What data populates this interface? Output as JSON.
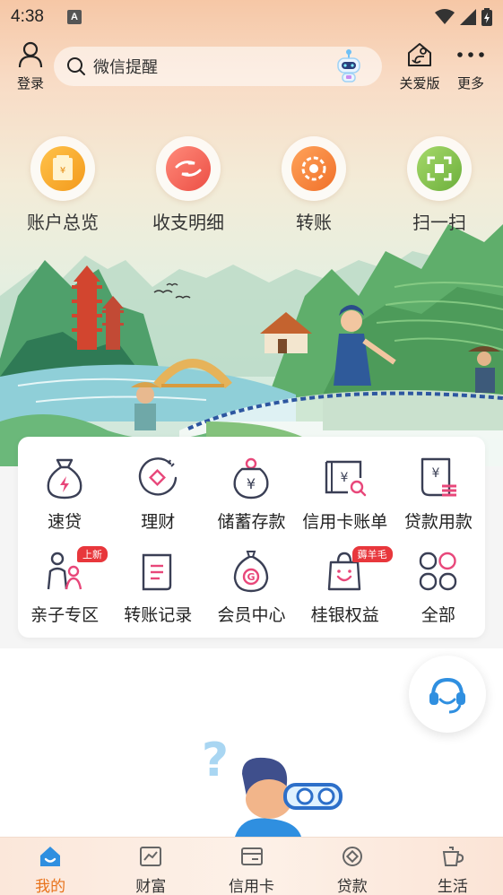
{
  "status_bar": {
    "time": "4:38",
    "notification_letter": "A"
  },
  "top_nav": {
    "login_label": "登录",
    "search_placeholder": "微信提醒",
    "care_label": "关爱版",
    "more_label": "更多"
  },
  "quick_actions": [
    {
      "label": "账户总览",
      "icon": "account-icon",
      "color": "#f5a623"
    },
    {
      "label": "收支明细",
      "icon": "income-expense-icon",
      "color": "#f06a5a"
    },
    {
      "label": "转账",
      "icon": "transfer-icon",
      "color": "#f58a3a"
    },
    {
      "label": "扫一扫",
      "icon": "scan-icon",
      "color": "#7fbf4d"
    }
  ],
  "services": [
    {
      "label": "速贷",
      "icon": "quick-loan-icon"
    },
    {
      "label": "理财",
      "icon": "wealth-icon"
    },
    {
      "label": "储蓄存款",
      "icon": "savings-icon"
    },
    {
      "label": "信用卡账单",
      "icon": "credit-bill-icon"
    },
    {
      "label": "贷款用款",
      "icon": "loan-use-icon"
    },
    {
      "label": "亲子专区",
      "icon": "family-icon",
      "badge": "上新"
    },
    {
      "label": "转账记录",
      "icon": "transfer-record-icon"
    },
    {
      "label": "会员中心",
      "icon": "member-icon"
    },
    {
      "label": "桂银权益",
      "icon": "benefits-icon",
      "badge": "薅羊毛"
    },
    {
      "label": "全部",
      "icon": "all-icon"
    }
  ],
  "tabs": [
    {
      "label": "我的",
      "icon": "home-icon",
      "active": true
    },
    {
      "label": "财富",
      "icon": "wealth-chart-icon",
      "active": false
    },
    {
      "label": "信用卡",
      "icon": "card-icon",
      "active": false
    },
    {
      "label": "贷款",
      "icon": "loan-icon",
      "active": false
    },
    {
      "label": "生活",
      "icon": "life-cup-icon",
      "active": false
    }
  ],
  "colors": {
    "accent": "#e8731c",
    "icon_dark": "#3a3f55",
    "icon_pink": "#e8477a",
    "badge": "#e8373c"
  }
}
